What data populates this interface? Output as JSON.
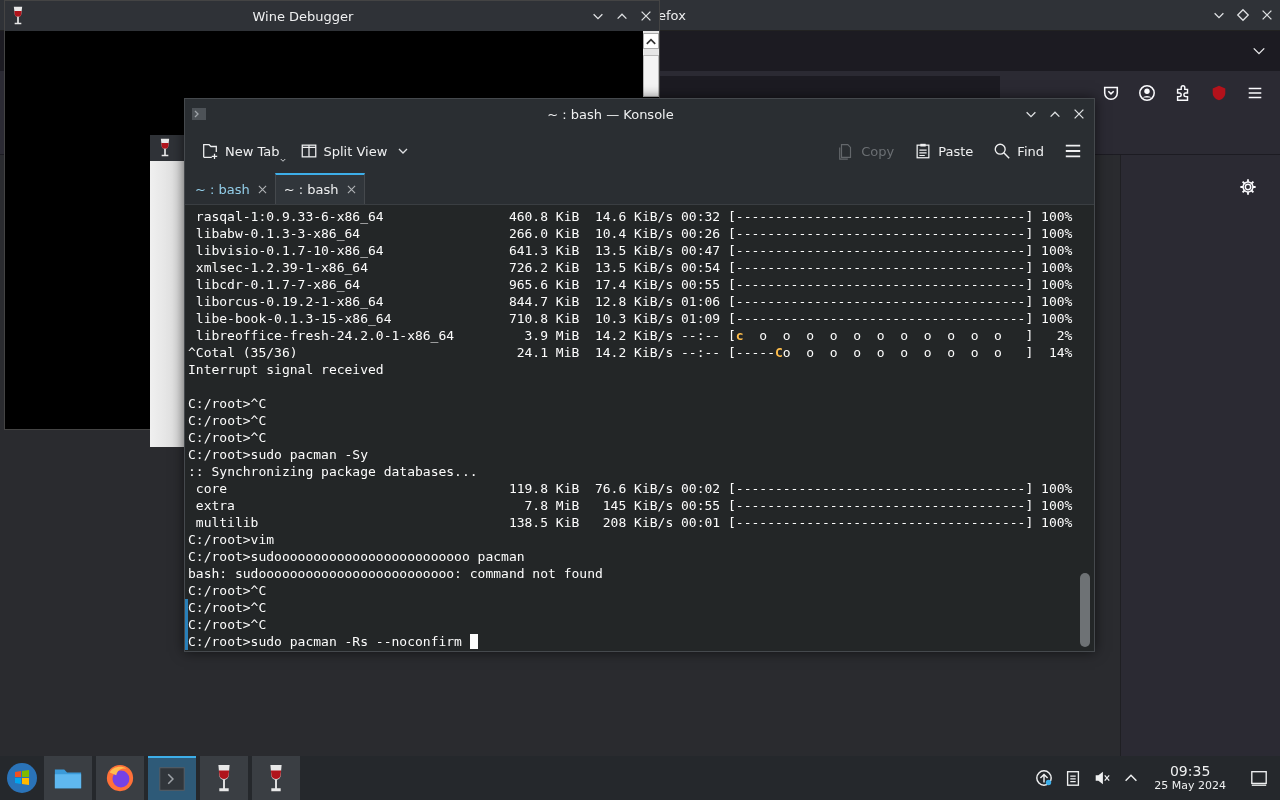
{
  "firefox": {
    "title": "efox"
  },
  "wine_debugger": {
    "title": "Wine Debugger"
  },
  "konsole": {
    "title": "~ : bash — Konsole",
    "toolbar_left": [
      {
        "kind": "new-tab",
        "label": "New Tab",
        "disabled": false
      },
      {
        "kind": "split-view",
        "label": "Split View",
        "disabled": false
      }
    ],
    "toolbar_right": [
      {
        "kind": "copy",
        "label": "Copy",
        "disabled": true
      },
      {
        "kind": "paste",
        "label": "Paste",
        "disabled": false
      },
      {
        "kind": "find",
        "label": "Find",
        "disabled": false
      }
    ],
    "tabs": [
      {
        "label": "~ : bash",
        "selected": false
      },
      {
        "label": "~ : bash",
        "selected": true
      }
    ],
    "lines": [
      {
        "kind": "progress",
        "name": "rasqal-1:0.9.33-6-x86_64",
        "size": "460.8 KiB",
        "rate": "14.6 KiB/s",
        "time": "00:32",
        "bar": {
          "start": "[-------------------------------------]"
        },
        "percent": "100%",
        "marked": false
      },
      {
        "kind": "progress",
        "name": "libabw-0.1.3-3-x86_64",
        "size": "266.0 KiB",
        "rate": "10.4 KiB/s",
        "time": "00:26",
        "bar": {
          "start": "[-------------------------------------]"
        },
        "percent": "100%",
        "marked": false
      },
      {
        "kind": "progress",
        "name": "libvisio-0.1.7-10-x86_64",
        "size": "641.3 KiB",
        "rate": "13.5 KiB/s",
        "time": "00:47",
        "bar": {
          "start": "[-------------------------------------]"
        },
        "percent": "100%",
        "marked": false
      },
      {
        "kind": "progress",
        "name": "xmlsec-1.2.39-1-x86_64",
        "size": "726.2 KiB",
        "rate": "13.5 KiB/s",
        "time": "00:54",
        "bar": {
          "start": "[-------------------------------------]"
        },
        "percent": "100%",
        "marked": false
      },
      {
        "kind": "progress",
        "name": "libcdr-0.1.7-7-x86_64",
        "size": "965.6 KiB",
        "rate": "17.4 KiB/s",
        "time": "00:55",
        "bar": {
          "start": "[-------------------------------------]"
        },
        "percent": "100%",
        "marked": false
      },
      {
        "kind": "progress",
        "name": "liborcus-0.19.2-1-x86_64",
        "size": "844.7 KiB",
        "rate": "12.8 KiB/s",
        "time": "01:06",
        "bar": {
          "start": "[-------------------------------------]"
        },
        "percent": "100%",
        "marked": false
      },
      {
        "kind": "progress",
        "name": "libe-book-0.1.3-15-x86_64",
        "size": "710.8 KiB",
        "rate": "10.3 KiB/s",
        "time": "01:09",
        "bar": {
          "start": "[-------------------------------------]"
        },
        "percent": "100%",
        "marked": false
      },
      {
        "kind": "progress",
        "name": "libreoffice-fresh-24.2.0-1-x86_64",
        "size": "3.9 MiB",
        "rate": "14.2 KiB/s",
        "time": "--:--",
        "bar": {
          "start": "[",
          "pacman": "c",
          "end": "  o  o  o  o  o  o  o  o  o  o  o   ]"
        },
        "percent": "2%",
        "marked": false
      },
      {
        "kind": "total",
        "name": "^Cotal (35/36)",
        "size": "24.1 MiB",
        "rate": "14.2 KiB/s",
        "time": "--:--",
        "bar": {
          "start": "[-----",
          "pacman": "C",
          "end": "o  o  o  o  o  o  o  o  o  o   ]"
        },
        "percent": "14%",
        "marked": false
      },
      {
        "kind": "text",
        "text": "Interrupt signal received",
        "marked": false
      },
      {
        "kind": "blank",
        "marked": false
      },
      {
        "kind": "text",
        "text": "C:/root>^C",
        "marked": false
      },
      {
        "kind": "text",
        "text": "C:/root>^C",
        "marked": false
      },
      {
        "kind": "text",
        "text": "C:/root>^C",
        "marked": false
      },
      {
        "kind": "text",
        "text": "C:/root>sudo pacman -Sy",
        "marked": false
      },
      {
        "kind": "text",
        "text": ":: Synchronizing package databases...",
        "marked": false
      },
      {
        "kind": "progress",
        "name": "core",
        "size": "119.8 KiB",
        "rate": "76.6 KiB/s",
        "time": "00:02",
        "bar": {
          "start": "[-------------------------------------]"
        },
        "percent": "100%",
        "marked": false
      },
      {
        "kind": "progress",
        "name": "extra",
        "size": "7.8 MiB",
        "rate": "145 KiB/s",
        "time": "00:55",
        "bar": {
          "start": "[-------------------------------------]"
        },
        "percent": "100%",
        "marked": false
      },
      {
        "kind": "progress",
        "name": "multilib",
        "size": "138.5 KiB",
        "rate": "208 KiB/s",
        "time": "00:01",
        "bar": {
          "start": "[-------------------------------------]"
        },
        "percent": "100%",
        "marked": false
      },
      {
        "kind": "text",
        "text": "C:/root>vim",
        "marked": false
      },
      {
        "kind": "text",
        "text": "C:/root>sudooooooooooooooooooooooooo pacman",
        "marked": false
      },
      {
        "kind": "text",
        "text": "bash: sudooooooooooooooooooooooooo: command not found",
        "marked": false
      },
      {
        "kind": "text",
        "text": "C:/root>^C",
        "marked": false
      },
      {
        "kind": "text",
        "text": "C:/root>^C",
        "marked": true
      },
      {
        "kind": "text",
        "text": "C:/root>^C",
        "marked": true
      },
      {
        "kind": "input",
        "text": "C:/root>sudo pacman -Rs --noconfirm",
        "marked": true
      }
    ]
  },
  "taskbar": {
    "apps": [
      {
        "kind": "folder",
        "active": false
      },
      {
        "kind": "firefox",
        "active": false
      },
      {
        "kind": "terminal",
        "active": true
      },
      {
        "kind": "wine",
        "active": false
      },
      {
        "kind": "wine",
        "active": false
      }
    ],
    "clock": {
      "time": "09:35",
      "date": "25 May 2024"
    }
  }
}
